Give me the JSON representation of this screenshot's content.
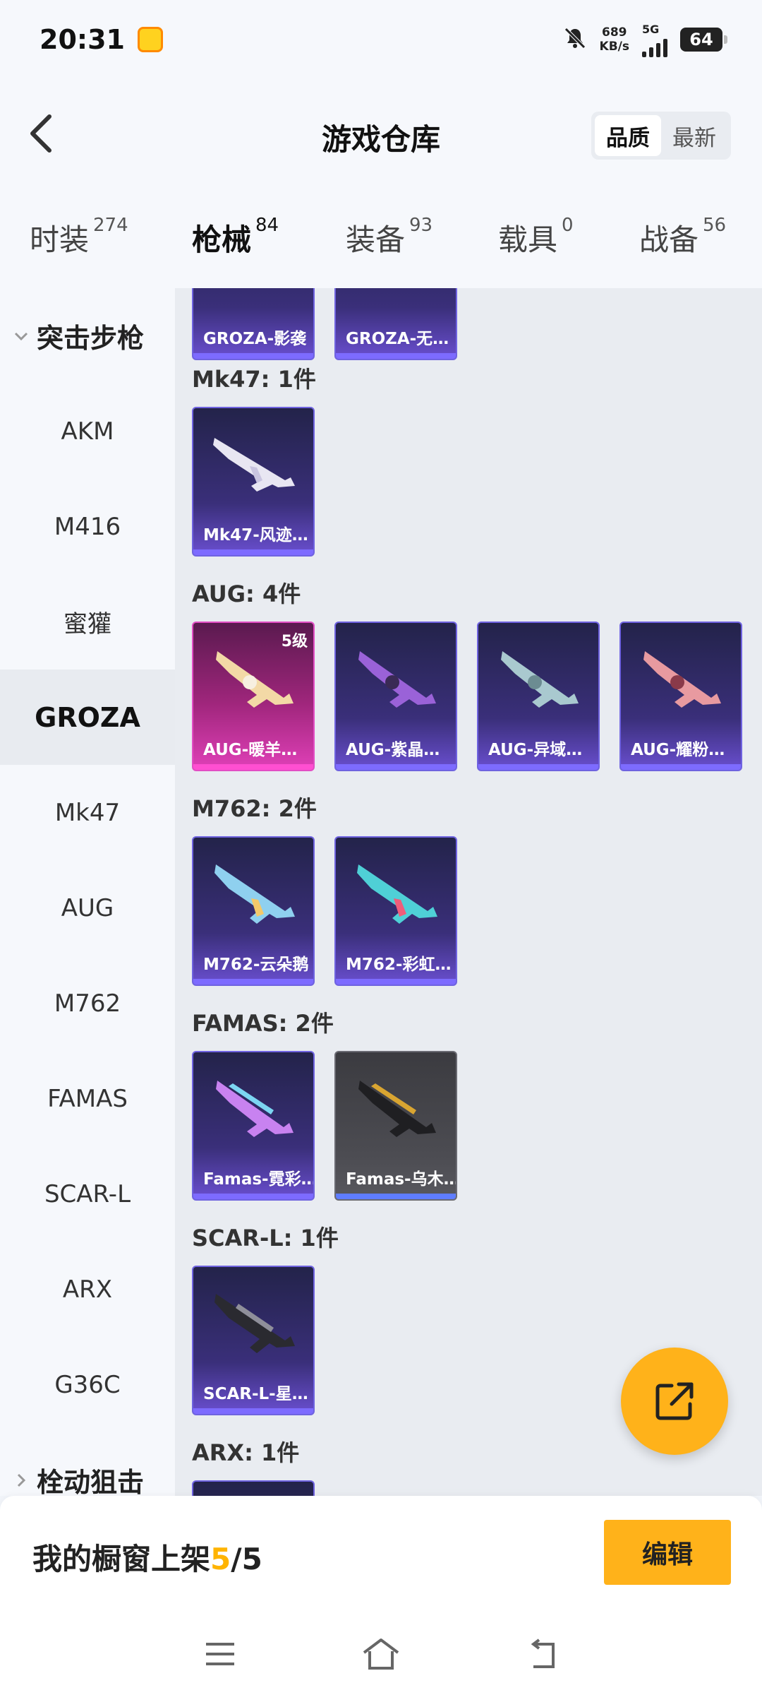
{
  "status_bar": {
    "time": "20:31",
    "speed_value": "689",
    "speed_unit": "KB/s",
    "network": "5G",
    "battery": "64"
  },
  "header": {
    "title": "游戏仓库",
    "sort_options": [
      "品质",
      "最新"
    ],
    "active_sort": "品质"
  },
  "tabs": [
    {
      "label": "时装",
      "count": "274"
    },
    {
      "label": "枪械",
      "count": "84"
    },
    {
      "label": "装备",
      "count": "93"
    },
    {
      "label": "载具",
      "count": "0"
    },
    {
      "label": "战备",
      "count": "56"
    }
  ],
  "active_tab": "枪械",
  "sidebar": {
    "group_expanded": "突击步枪",
    "items": [
      "AKM",
      "M416",
      "蜜獾",
      "GROZA",
      "Mk47",
      "AUG",
      "M762",
      "FAMAS",
      "SCAR-L",
      "ARX",
      "G36C"
    ],
    "selected": "GROZA",
    "group_collapsed": "栓动狙击"
  },
  "sections": {
    "groza_partial": {
      "cards": [
        {
          "name": "GROZA-影袭"
        },
        {
          "name": "GROZA-无…"
        }
      ]
    },
    "mk47": {
      "title": "Mk47: 1件",
      "cards": [
        {
          "name": "Mk47-风迹…"
        }
      ]
    },
    "aug": {
      "title": "AUG: 4件",
      "cards": [
        {
          "name": "AUG-暖羊…",
          "level": "5级"
        },
        {
          "name": "AUG-紫晶…"
        },
        {
          "name": "AUG-异域…"
        },
        {
          "name": "AUG-耀粉…"
        }
      ]
    },
    "m762": {
      "title": "M762: 2件",
      "cards": [
        {
          "name": "M762-云朵鹅"
        },
        {
          "name": "M762-彩虹…"
        }
      ]
    },
    "famas": {
      "title": "FAMAS: 2件",
      "cards": [
        {
          "name": "Famas-霓彩…"
        },
        {
          "name": "Famas-乌木…"
        }
      ]
    },
    "scarl": {
      "title": "SCAR-L: 1件",
      "cards": [
        {
          "name": "SCAR-L-星…"
        }
      ]
    },
    "arx": {
      "title": "ARX: 1件"
    }
  },
  "bottom": {
    "showcase_prefix": "我的橱窗上架",
    "showcase_current": "5",
    "showcase_total": "/5",
    "edit_label": "编辑"
  },
  "colors": {
    "accent": "#ffb21a",
    "card_purple": "#3a2f7a",
    "card_pink": "#e040b8",
    "card_gray": "#4c4c52"
  }
}
